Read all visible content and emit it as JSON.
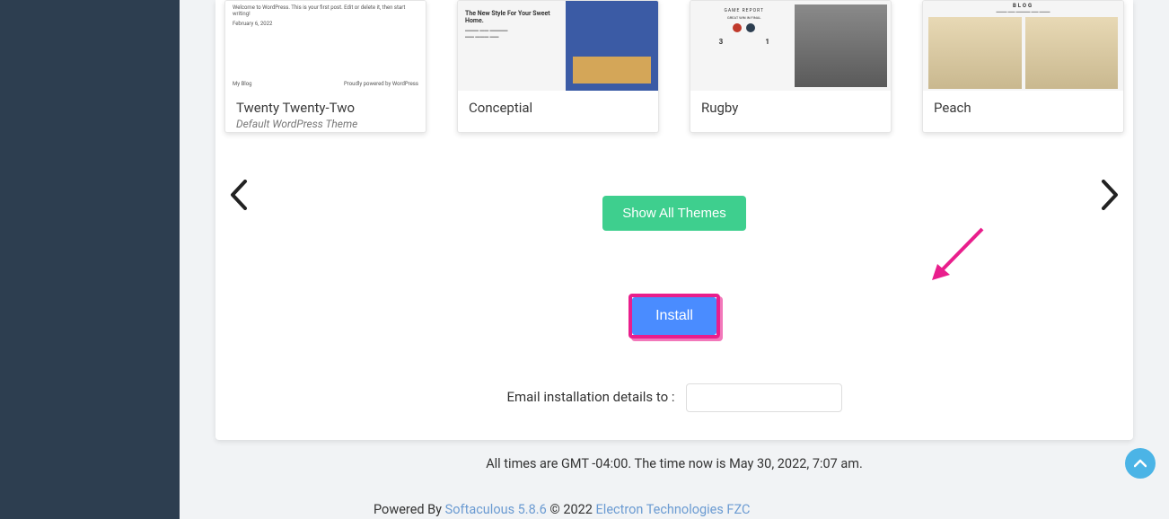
{
  "themes": [
    {
      "title": "Twenty Twenty-Two",
      "subtitle": "Default WordPress Theme"
    },
    {
      "title": "Conceptial"
    },
    {
      "title": "Rugby"
    },
    {
      "title": "Peach"
    }
  ],
  "preview": {
    "twentytwo_welcome": "Welcome to WordPress. This is your first post. Edit or delete it, then start writing!",
    "twentytwo_date": "February 6, 2022",
    "twentytwo_blog": "My Blog",
    "twentytwo_powered": "Proudly powered by WordPress",
    "conceptial_heading": "The New Style For Your Sweet Home.",
    "rugby_header": "GAME REPORT",
    "rugby_sub": "GREAT WIN IN FINAL",
    "peach_header": "BLOG"
  },
  "buttons": {
    "show_all": "Show All Themes",
    "install": "Install"
  },
  "email": {
    "label": "Email installation details to :"
  },
  "footer": {
    "time_text": "All times are GMT -04:00. The time now is May 30, 2022, 7:07 am.",
    "powered_prefix": "Powered By ",
    "softaculous": "Softaculous 5.8.6",
    "copyright": " © 2022 ",
    "company": "Electron Technologies FZC"
  }
}
